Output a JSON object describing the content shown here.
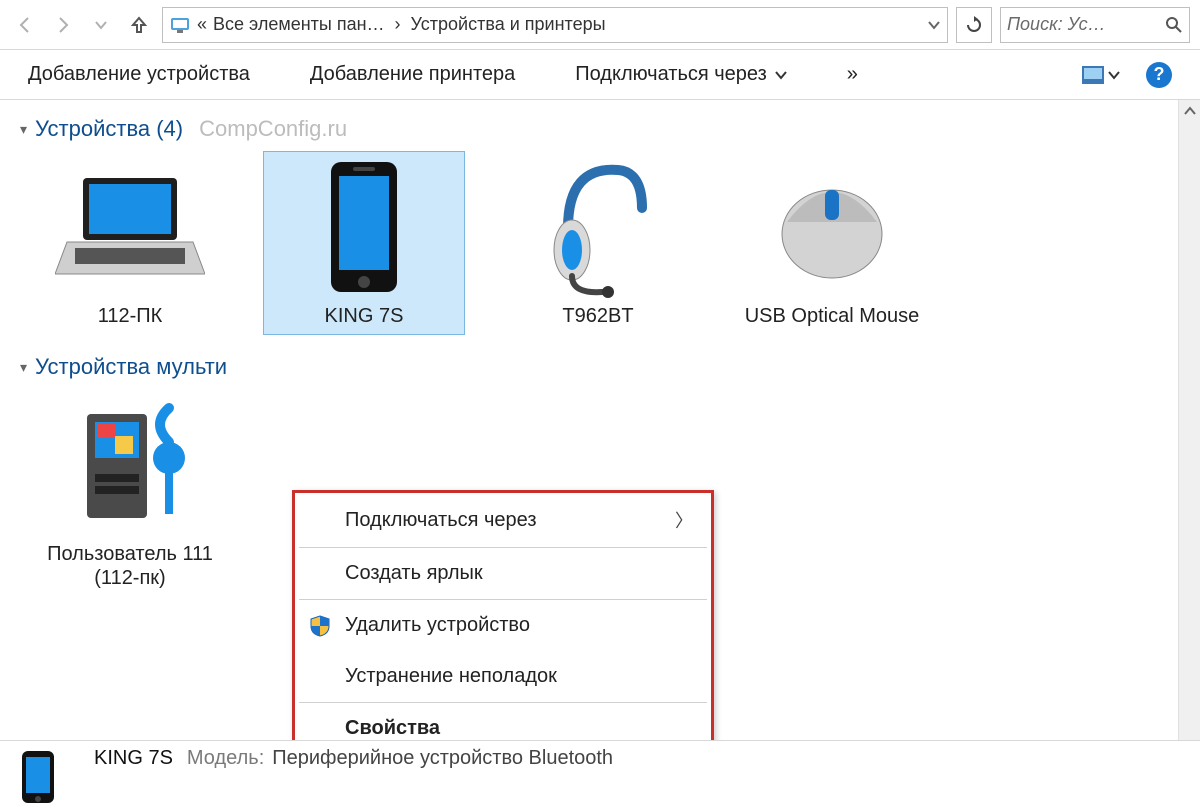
{
  "breadcrumb": {
    "prefix": "«",
    "path": [
      "Все элементы пан…",
      "Устройства и принтеры"
    ]
  },
  "search": {
    "placeholder": "Поиск: Ус…"
  },
  "commands": {
    "add_device": "Добавление устройства",
    "add_printer": "Добавление принтера",
    "connect_via": "Подключаться через",
    "overflow": "»"
  },
  "groups": [
    {
      "title": "Устройства (4)",
      "watermark": "CompConfig.ru"
    },
    {
      "title": "Устройства мульти"
    }
  ],
  "devices": [
    {
      "name": "112-ПК",
      "icon": "laptop"
    },
    {
      "name": "KING 7S",
      "icon": "phone",
      "selected": true
    },
    {
      "name": "T962BT",
      "icon": "headset"
    },
    {
      "name": "USB Optical Mouse",
      "icon": "mouse"
    }
  ],
  "multimedia": [
    {
      "name": "Пользователь 111 (112-пк)",
      "icon": "media-server"
    }
  ],
  "context_menu": {
    "items": [
      {
        "label": "Подключаться через",
        "has_submenu": true
      },
      {
        "sep": true
      },
      {
        "label": "Создать ярлык"
      },
      {
        "sep": true
      },
      {
        "label": "Удалить устройство",
        "shield": true
      },
      {
        "label": "Устранение неполадок"
      },
      {
        "sep": true
      },
      {
        "label": "Свойства",
        "bold": true
      }
    ]
  },
  "details": {
    "title": "KING 7S",
    "model_label": "Модель:",
    "model_value": "Периферийное устройство Bluetooth"
  }
}
